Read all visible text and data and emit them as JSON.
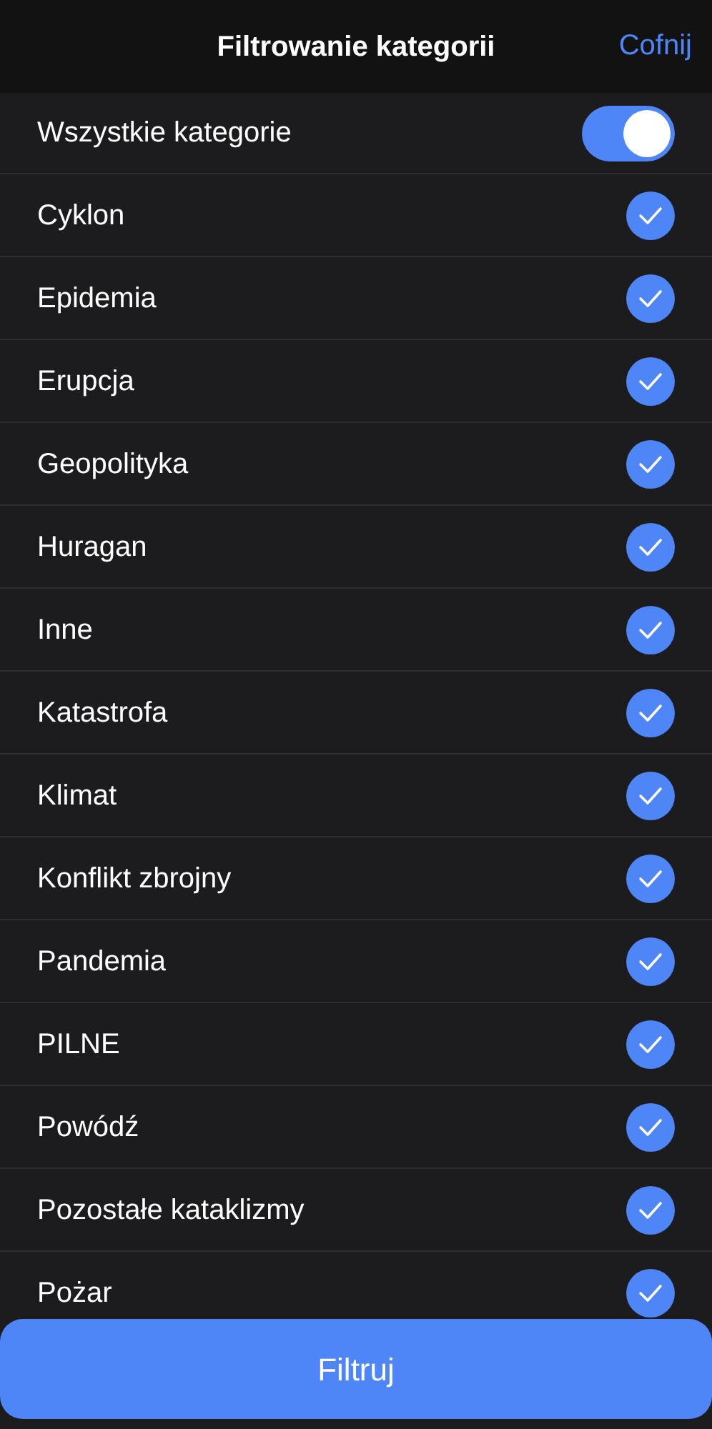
{
  "header": {
    "title": "Filtrowanie kategorii",
    "back": "Cofnij"
  },
  "all_toggle": {
    "label": "Wszystkie kategorie",
    "on": true
  },
  "categories": [
    {
      "label": "Cyklon",
      "checked": true
    },
    {
      "label": "Epidemia",
      "checked": true
    },
    {
      "label": "Erupcja",
      "checked": true
    },
    {
      "label": "Geopolityka",
      "checked": true
    },
    {
      "label": "Huragan",
      "checked": true
    },
    {
      "label": "Inne",
      "checked": true
    },
    {
      "label": "Katastrofa",
      "checked": true
    },
    {
      "label": "Klimat",
      "checked": true
    },
    {
      "label": "Konflikt zbrojny",
      "checked": true
    },
    {
      "label": "Pandemia",
      "checked": true
    },
    {
      "label": "PILNE",
      "checked": true
    },
    {
      "label": "Powódź",
      "checked": true
    },
    {
      "label": "Pozostałe kataklizmy",
      "checked": true
    },
    {
      "label": "Pożar",
      "checked": true
    }
  ],
  "filter_button": "Filtruj"
}
